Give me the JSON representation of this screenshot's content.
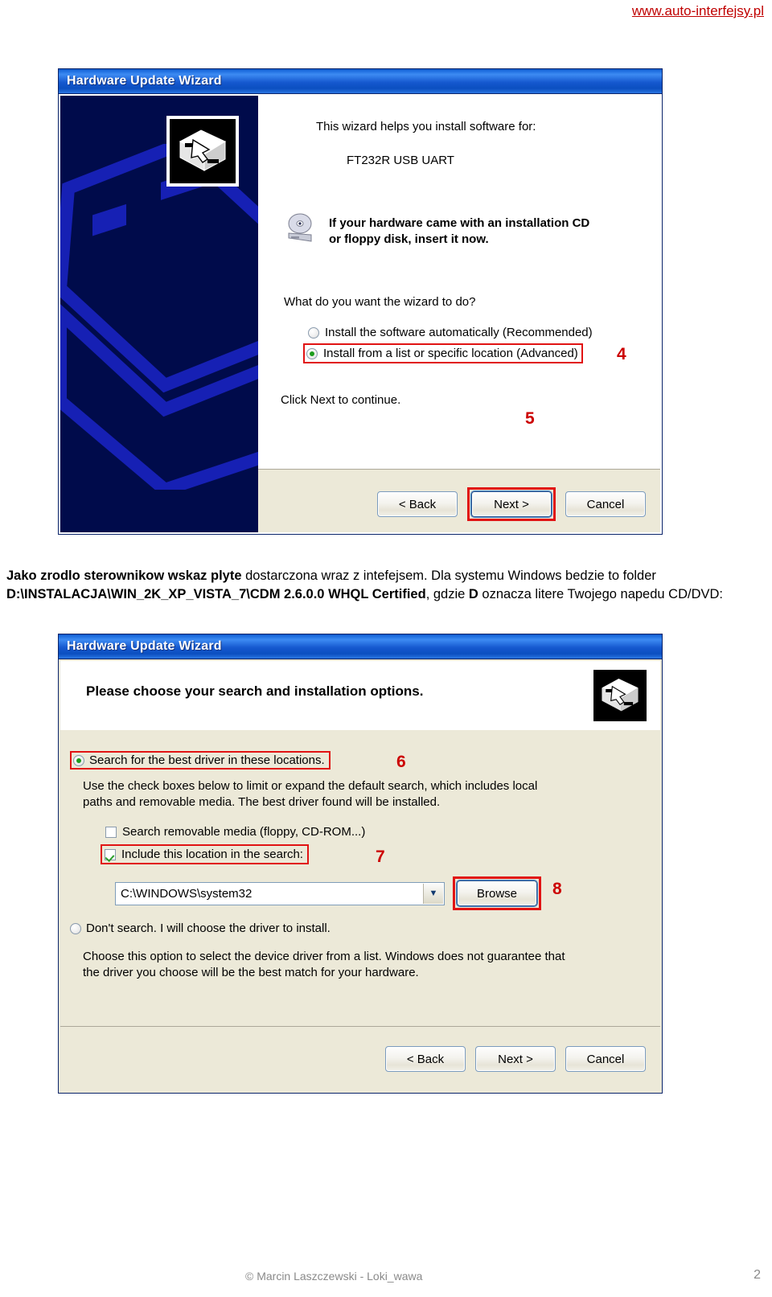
{
  "site": {
    "watermark_url": "www.auto-interfejsy.pl",
    "watermark_color": "#c00000"
  },
  "dialog1": {
    "title": "Hardware Update Wizard",
    "intro": "This wizard helps you install software for:",
    "device": "FT232R USB UART",
    "cd_notice_line1": "If your hardware came with an installation CD",
    "cd_notice_line2": "or floppy disk, insert it now.",
    "question": "What do you want the wizard to do?",
    "options": [
      {
        "label": "Install the software automatically (Recommended)",
        "selected": false
      },
      {
        "label": "Install from a list or specific location (Advanced)",
        "selected": true
      }
    ],
    "click_next": "Click Next to continue.",
    "buttons": {
      "back": "< Back",
      "next": "Next >",
      "cancel": "Cancel"
    },
    "callouts": {
      "option_advanced": "4",
      "next_button": "5"
    }
  },
  "body_text": {
    "b1": "Jako zrodlo sterownikow wskaz plyte",
    "t1": " dostarczona wraz z intefejsem. Dla systemu Windows bedzie to folder ",
    "b2": "D:\\INSTALACJA\\WIN_2K_XP_VISTA_7\\CDM 2.6.0.0 WHQL Certified",
    "t2": ", gdzie ",
    "b3": "D",
    "t3": " oznacza litere Twojego napedu CD/DVD:"
  },
  "dialog2": {
    "title": "Hardware Update Wizard",
    "heading": "Please choose your search and installation options.",
    "search_option": {
      "label": "Search for the best driver in these locations.",
      "selected": true
    },
    "help_line1": "Use the check boxes below to limit or expand the default search, which includes local",
    "help_line2": "paths and removable media. The best driver found will be installed.",
    "checkbox_removable": {
      "label": "Search removable media (floppy, CD-ROM...)",
      "checked": false
    },
    "checkbox_location": {
      "label": "Include this location in the search:",
      "checked": true
    },
    "location_value": "C:\\WINDOWS\\system32",
    "browse_label": "Browse",
    "dont_search_option": {
      "label": "Don't search. I will choose the driver to install.",
      "selected": false
    },
    "help2_line1": "Choose this option to select the device driver from a list.  Windows does not guarantee that",
    "help2_line2": "the driver you choose will be the best match for your hardware.",
    "buttons": {
      "back": "< Back",
      "next": "Next >",
      "cancel": "Cancel"
    },
    "callouts": {
      "search_option": "6",
      "include_location": "7",
      "browse_button": "8"
    }
  },
  "footer": {
    "copyright": "© Marcin Laszczewski - Loki_wawa",
    "page_number": "2"
  }
}
